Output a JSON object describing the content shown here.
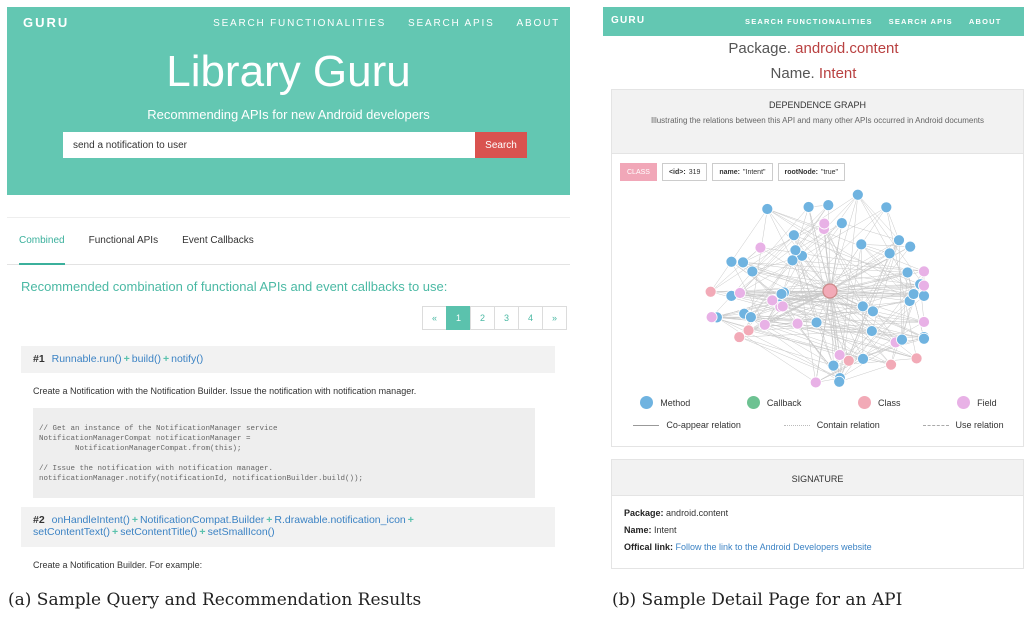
{
  "panel_a": {
    "brand": "GURU",
    "nav": [
      "SEARCH FUNCTIONALITIES",
      "SEARCH APIS",
      "ABOUT"
    ],
    "title": "Library Guru",
    "subtitle": "Recommending APIs for new Android developers",
    "search": {
      "value": "send a notification to user",
      "button": "Search"
    },
    "tabs": [
      "Combined",
      "Functional APIs",
      "Event Callbacks"
    ],
    "heading": "Recommended combination of functional APIs and event callbacks to use:",
    "pagination": [
      "«",
      "1",
      "2",
      "3",
      "4",
      "»"
    ],
    "result1": {
      "num": "#1",
      "apis": [
        "Runnable.run()",
        "build()",
        "notify()"
      ],
      "desc": "Create a Notification with the Notification Builder. Issue the notification with notification manager.",
      "code": "// Get an instance of the NotificationManager service\nNotificationManagerCompat notificationManager =\n        NotificationManagerCompat.from(this);\n\n// Issue the notification with notification manager.\nnotificationManager.notify(notificationId, notificationBuilder.build());"
    },
    "result2": {
      "num": "#2",
      "apis_line1": [
        "onHandleIntent()",
        "NotificationCompat.Builder",
        "R.drawable.notification_icon"
      ],
      "apis_line2": [
        "setContentText()",
        "setContentTitle()",
        "setSmallIcon()"
      ],
      "desc": "Create a Notification Builder. For example:"
    }
  },
  "panel_b": {
    "brand": "GURU",
    "nav": [
      "SEARCH FUNCTIONALITIES",
      "SEARCH APIS",
      "ABOUT"
    ],
    "package_label": "Package.",
    "package_value": "android.content",
    "name_label": "Name.",
    "name_value": "Intent",
    "graph": {
      "title": "DEPENDENCE GRAPH",
      "subtitle": "Illustrating the relations between this API and many other APIs occurred in Android documents",
      "tags": {
        "class": "CLASS",
        "id_key": "<id>:",
        "id_val": "319",
        "name_key": "name:",
        "name_val": "\"Intent\"",
        "root_key": "rootNode:",
        "root_val": "\"true\""
      },
      "legend": [
        "Method",
        "Callback",
        "Class",
        "Field"
      ],
      "relations": [
        "Co-appear relation",
        "Contain relation",
        "Use relation"
      ],
      "colors": {
        "method": "#6fb3e0",
        "callback": "#6dc292",
        "class": "#f2aab7",
        "field": "#e8b1e6"
      }
    },
    "signature": {
      "title": "SIGNATURE",
      "package_key": "Package:",
      "package_val": "android.content",
      "name_key": "Name:",
      "name_val": "Intent",
      "link_key": "Offical link:",
      "link_val": "Follow the link to the Android Developers website"
    }
  },
  "captions": [
    "(a) Sample Query and Recommendation Results",
    "(b) Sample Detail Page for an API"
  ]
}
